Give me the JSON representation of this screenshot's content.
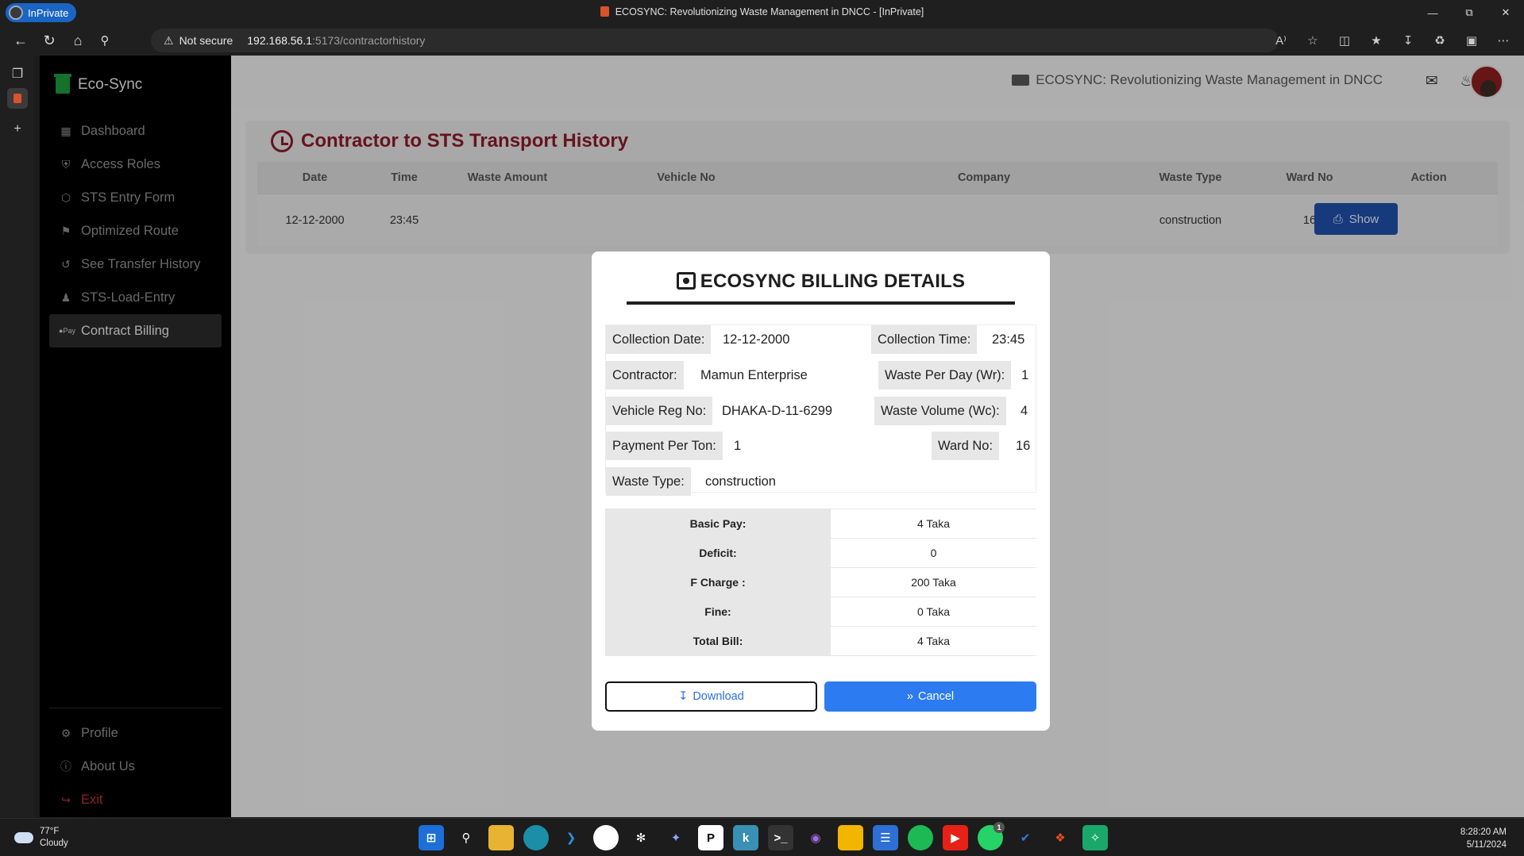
{
  "browser": {
    "inprivate_label": "InPrivate",
    "window_title": "ECOSYNC: Revolutionizing Waste Management in DNCC - [InPrivate]",
    "not_secure": "Not secure",
    "url_host": "192.168.56.1",
    "url_path": ":5173/contractorhistory"
  },
  "sidebar": {
    "brand": "Eco-Sync",
    "items": [
      {
        "label": "Dashboard",
        "icon": "grid-icon"
      },
      {
        "label": "Access Roles",
        "icon": "shield-icon"
      },
      {
        "label": "STS Entry Form",
        "icon": "box-icon"
      },
      {
        "label": "Optimized Route",
        "icon": "map-icon"
      },
      {
        "label": "See Transfer History",
        "icon": "history-icon"
      },
      {
        "label": "STS-Load-Entry",
        "icon": "users-icon"
      },
      {
        "label": "Contract Billing",
        "icon": "pay-icon",
        "icon_text": "●Pay"
      }
    ],
    "bottom": [
      {
        "label": "Profile",
        "icon": "gear-icon"
      },
      {
        "label": "About Us",
        "icon": "help-icon"
      },
      {
        "label": "Exit",
        "icon": "exit-icon"
      }
    ]
  },
  "topbar": {
    "title": "ECOSYNC: Revolutionizing Waste Management in DNCC"
  },
  "page": {
    "title": "Contractor to STS Transport History",
    "columns": [
      "Date",
      "Time",
      "Waste Amount",
      "Vehicle No",
      "Company",
      "Waste Type",
      "Ward No",
      "Action"
    ],
    "rows": [
      {
        "date": "12-12-2000",
        "time": "23:45",
        "waste_amount": "",
        "vehicle_no": "",
        "company": "",
        "waste_type": "construction",
        "ward_no": "16",
        "action": "Show"
      }
    ]
  },
  "modal": {
    "title": "ECOSYNC BILLING DETAILS",
    "fields": {
      "collection_date_label": "Collection Date:",
      "collection_date": "12-12-2000",
      "collection_time_label": "Collection Time:",
      "collection_time": "23:45",
      "contractor_label": "Contractor:",
      "contractor": "Mamun Enterprise",
      "waste_per_day_label": "Waste Per Day (Wr):",
      "waste_per_day": "1",
      "vehicle_reg_label": "Vehicle Reg No:",
      "vehicle_reg": "DHAKA-D-11-6299",
      "waste_volume_label": "Waste Volume (Wc):",
      "waste_volume": "4",
      "payment_per_ton_label": "Payment Per Ton:",
      "payment_per_ton": "1",
      "ward_no_label": "Ward No:",
      "ward_no": "16",
      "waste_type_label": "Waste Type:",
      "waste_type": "construction"
    },
    "bill": [
      {
        "label": "Basic Pay:",
        "value": "4 Taka"
      },
      {
        "label": "Deficit:",
        "value": "0"
      },
      {
        "label": "F Charge :",
        "value": "200 Taka"
      },
      {
        "label": "Fine:",
        "value": "0 Taka"
      },
      {
        "label": "Total Bill:",
        "value": "4 Taka"
      }
    ],
    "download_label": "Download",
    "cancel_label": "Cancel"
  },
  "taskbar": {
    "temperature": "77°F",
    "weather": "Cloudy",
    "time": "8:28:20 AM",
    "date": "5/11/2024",
    "notification_badge": "1"
  }
}
